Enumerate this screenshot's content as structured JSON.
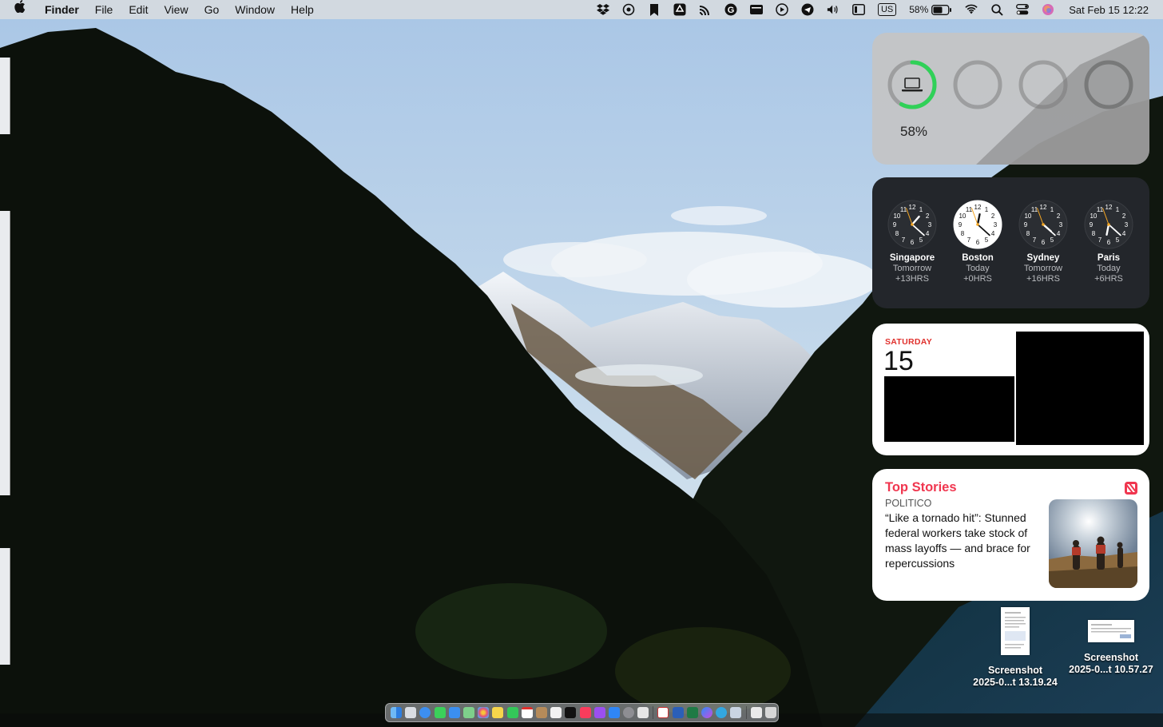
{
  "menubar": {
    "apple_icon": "apple-logo-icon",
    "app_name": "Finder",
    "menus": [
      "File",
      "Edit",
      "View",
      "Go",
      "Window",
      "Help"
    ],
    "keyboard_input": "US",
    "battery_percent": "58%",
    "datetime": "Sat Feb 15  12:22"
  },
  "battery_widget": {
    "level": 0.58,
    "percent_label": "58%",
    "device_icon": "laptop-icon",
    "accent": "#30d158"
  },
  "clock_widget": {
    "clocks": [
      {
        "city": "Singapore",
        "day": "Tomorrow",
        "offset": "+13HRS",
        "hour": 1,
        "minute": 22,
        "face": "dark"
      },
      {
        "city": "Boston",
        "day": "Today",
        "offset": "+0HRS",
        "hour": 12,
        "minute": 22,
        "face": "light"
      },
      {
        "city": "Sydney",
        "day": "Tomorrow",
        "offset": "+16HRS",
        "hour": 4,
        "minute": 22,
        "face": "dark"
      },
      {
        "city": "Paris",
        "day": "Today",
        "offset": "+6HRS",
        "hour": 6,
        "minute": 22,
        "face": "dark"
      }
    ]
  },
  "calendar_widget": {
    "weekday": "SATURDAY",
    "date": "15",
    "accent": "#e0302c"
  },
  "news_widget": {
    "heading": "Top Stories",
    "source": "POLITICO",
    "headline": "“Like a tornado hit”: Stunned federal workers take stock of mass layoffs — and brace for repercussions",
    "accent": "#f0364f",
    "icon": "apple-news-icon"
  },
  "desktop_files": [
    {
      "line1": "Screenshot",
      "line2": "2025-0...t 13.19.24"
    },
    {
      "line1": "Screenshot",
      "line2": "2025-0...t 10.57.27"
    }
  ],
  "dock": {
    "apps": [
      "finder",
      "launchpad",
      "safari",
      "messages",
      "mail",
      "maps",
      "photos",
      "notes",
      "facetime",
      "calendar",
      "contacts",
      "reminders",
      "tv",
      "music",
      "podcasts",
      "app-store",
      "system-settings",
      "preview",
      "zotero",
      "word",
      "excel",
      "messenger",
      "telegram",
      "preview-2",
      "documents",
      "trash"
    ]
  }
}
